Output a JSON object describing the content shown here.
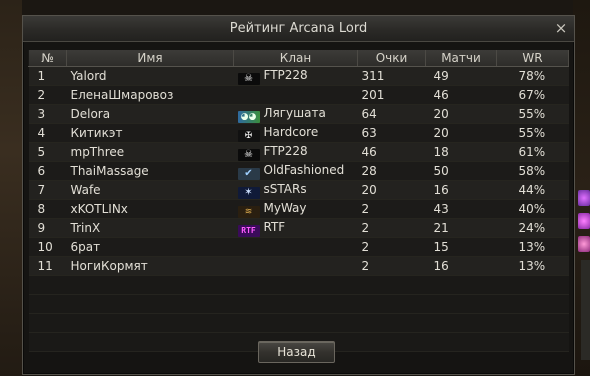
{
  "window": {
    "title": "Рейтинг Arcana Lord",
    "close_glyph": "×",
    "back_label": "Назад"
  },
  "table": {
    "columns": [
      "№",
      "Имя",
      "Клан",
      "Очки",
      "Матчи",
      "WR"
    ],
    "rows": [
      {
        "num": "1",
        "name": "Yalord",
        "crest_icon": "skull-crest-icon",
        "clan": "FTP228",
        "points": "311",
        "matches": "49",
        "wr": "78%"
      },
      {
        "num": "2",
        "name": "ЕленаШмаровоз",
        "crest_icon": "",
        "clan": "",
        "points": "201",
        "matches": "46",
        "wr": "67%"
      },
      {
        "num": "3",
        "name": "Delora",
        "crest_icon": "frog-crest-icon",
        "clan": "Лягушата",
        "points": "64",
        "matches": "20",
        "wr": "55%"
      },
      {
        "num": "4",
        "name": "Китикэт",
        "crest_icon": "bones-crest-icon",
        "clan": "Hardcore",
        "points": "63",
        "matches": "20",
        "wr": "55%"
      },
      {
        "num": "5",
        "name": "mpThree",
        "crest_icon": "skull-crest-icon",
        "clan": "FTP228",
        "points": "46",
        "matches": "18",
        "wr": "61%"
      },
      {
        "num": "6",
        "name": "ThaiMassage",
        "crest_icon": "check-crest-icon",
        "clan": "OldFashioned",
        "points": "28",
        "matches": "50",
        "wr": "58%"
      },
      {
        "num": "7",
        "name": "Wafe",
        "crest_icon": "star-crest-icon",
        "clan": "sSTARs",
        "points": "20",
        "matches": "16",
        "wr": "44%"
      },
      {
        "num": "8",
        "name": "xKOTLINx",
        "crest_icon": "wings-crest-icon",
        "clan": "MyWay",
        "points": "2",
        "matches": "43",
        "wr": "40%"
      },
      {
        "num": "9",
        "name": "TrinX",
        "crest_icon": "rtf-crest-icon",
        "clan": "RTF",
        "points": "2",
        "matches": "21",
        "wr": "24%"
      },
      {
        "num": "10",
        "name": "6рат",
        "crest_icon": "",
        "clan": "",
        "points": "2",
        "matches": "15",
        "wr": "13%"
      },
      {
        "num": "11",
        "name": "НогиКормят",
        "crest_icon": "",
        "clan": "",
        "points": "2",
        "matches": "16",
        "wr": "13%"
      }
    ],
    "rtf_crest_text": "RTF"
  },
  "colors": {
    "window_bg": "#151412",
    "title_text": "#dcdad2",
    "row_text": "#e2dfd6"
  }
}
